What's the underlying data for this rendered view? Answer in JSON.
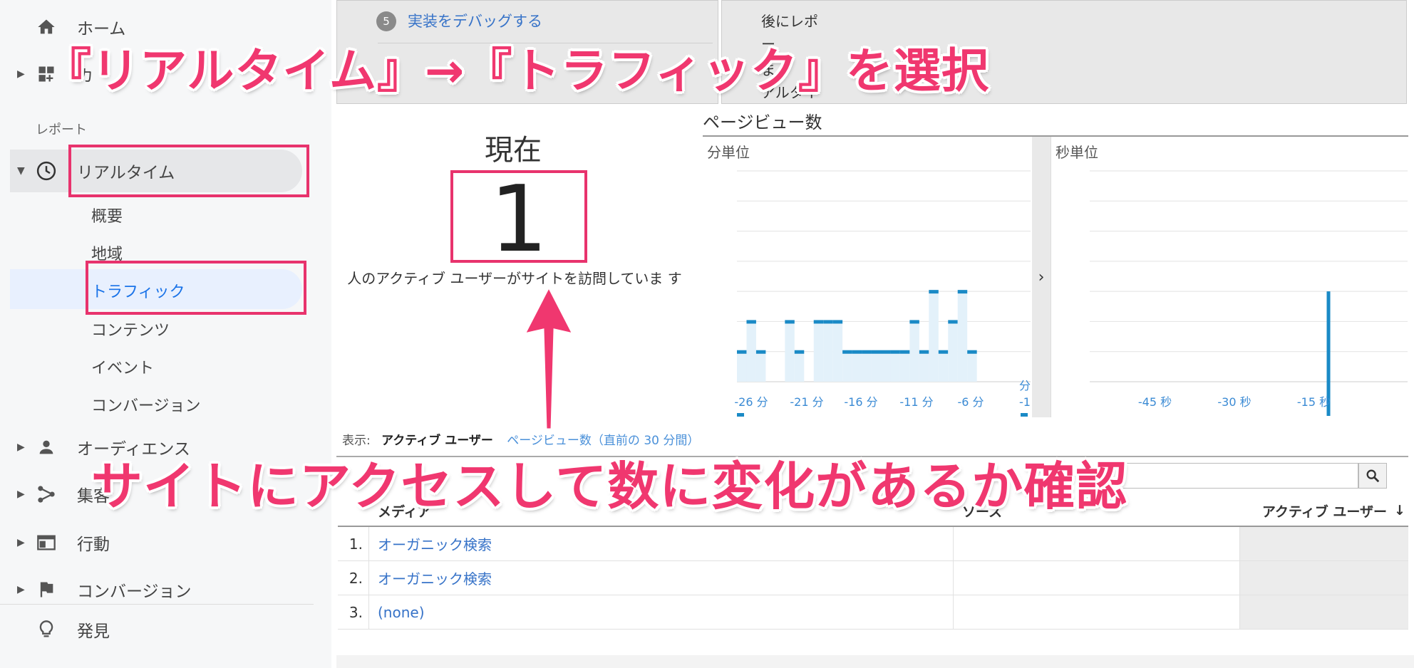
{
  "colors": {
    "accent": "#e8336d",
    "caption": "#f0376f",
    "link": "#3773c8",
    "bar": "#1a8ac6",
    "bar_fill": "#e3f1fa"
  },
  "sidebar": {
    "home": {
      "label": "ホーム",
      "icon": "home-icon"
    },
    "custom": {
      "label": "カ",
      "icon": "dashboard-add-icon"
    },
    "section_label": "レポート",
    "realtime": {
      "label": "リアルタイム",
      "icon": "clock-icon"
    },
    "sub_items": [
      "概要",
      "地域",
      "トラフィック",
      "コンテンツ",
      "イベント",
      "コンバージョン"
    ],
    "audience": {
      "label": "オーディエンス",
      "icon": "person-icon"
    },
    "acquisition": {
      "label": "集客",
      "icon": "acquisition-icon"
    },
    "behavior": {
      "label": "行動",
      "icon": "behavior-icon"
    },
    "conversion": {
      "label": "コンバージョン",
      "icon": "flag-icon"
    },
    "discover": {
      "label": "発見",
      "icon": "lightbulb-icon"
    }
  },
  "steps": {
    "number": "5",
    "link": "実装をデバッグする",
    "right_lines": [
      "後にレポ",
      "ー",
      "ま",
      "アルタイ"
    ]
  },
  "now": {
    "title": "現在",
    "value": "1",
    "description": "人のアクティブ ユーザーがサイトを訪問していま す"
  },
  "pageviews": {
    "title": "ページビュー数",
    "per_minute_label": "分単位",
    "per_second_label": "秒単位",
    "expand_icon": "chevron-right-icon"
  },
  "chart_data": [
    {
      "type": "bar",
      "title": "分単位",
      "categories": [
        "-30",
        "-29",
        "-28",
        "-27",
        "-26",
        "-25",
        "-24",
        "-23",
        "-22",
        "-21",
        "-20",
        "-19",
        "-18",
        "-17",
        "-16",
        "-15",
        "-14",
        "-13",
        "-12",
        "-11",
        "-10",
        "-9",
        "-8",
        "-7",
        "-6",
        "-5",
        "-4",
        "-3",
        "-2",
        "-1"
      ],
      "values": [
        1,
        2,
        1,
        0,
        0,
        2,
        1,
        0,
        2,
        2,
        2,
        1,
        1,
        1,
        1,
        1,
        1,
        1,
        2,
        1,
        3,
        1,
        2,
        3,
        1,
        0,
        0,
        0,
        0,
        0
      ],
      "tick_labels": [
        "-26 分",
        "-21 分",
        "-16 分",
        "-11 分",
        "-6 分",
        "-1"
      ],
      "axis_unit_label": "分",
      "ylim": [
        0,
        7
      ],
      "grid": true
    },
    {
      "type": "bar",
      "title": "秒単位",
      "categories": [
        "-59",
        "-15"
      ],
      "values": [
        0,
        3
      ],
      "tick_labels": [
        "-45 秒",
        "-30 秒",
        "-15 秒"
      ],
      "ylim": [
        0,
        7
      ],
      "grid": true
    }
  ],
  "display": {
    "label": "表示:",
    "active": "アクティブ ユーザー",
    "other": "ページビュー数（直前の 30 分間）"
  },
  "search": {
    "icon": "search-icon",
    "placeholder": ""
  },
  "table": {
    "headers": [
      "メディア",
      "ソース",
      "アクティブ ユーザー"
    ],
    "sort_icon": "arrow-down-icon",
    "rows": [
      {
        "idx": "1.",
        "medium": "オーガニック検索",
        "source": "",
        "active": ""
      },
      {
        "idx": "2.",
        "medium": "オーガニック検索",
        "source": "",
        "active": ""
      },
      {
        "idx": "3.",
        "medium": "(none)",
        "source": "",
        "active": ""
      }
    ]
  },
  "annotations": {
    "top": "『リアルタイム』→『トラフィック』を選択",
    "bottom": "サイトにアクセスして数に変化があるか確認"
  }
}
